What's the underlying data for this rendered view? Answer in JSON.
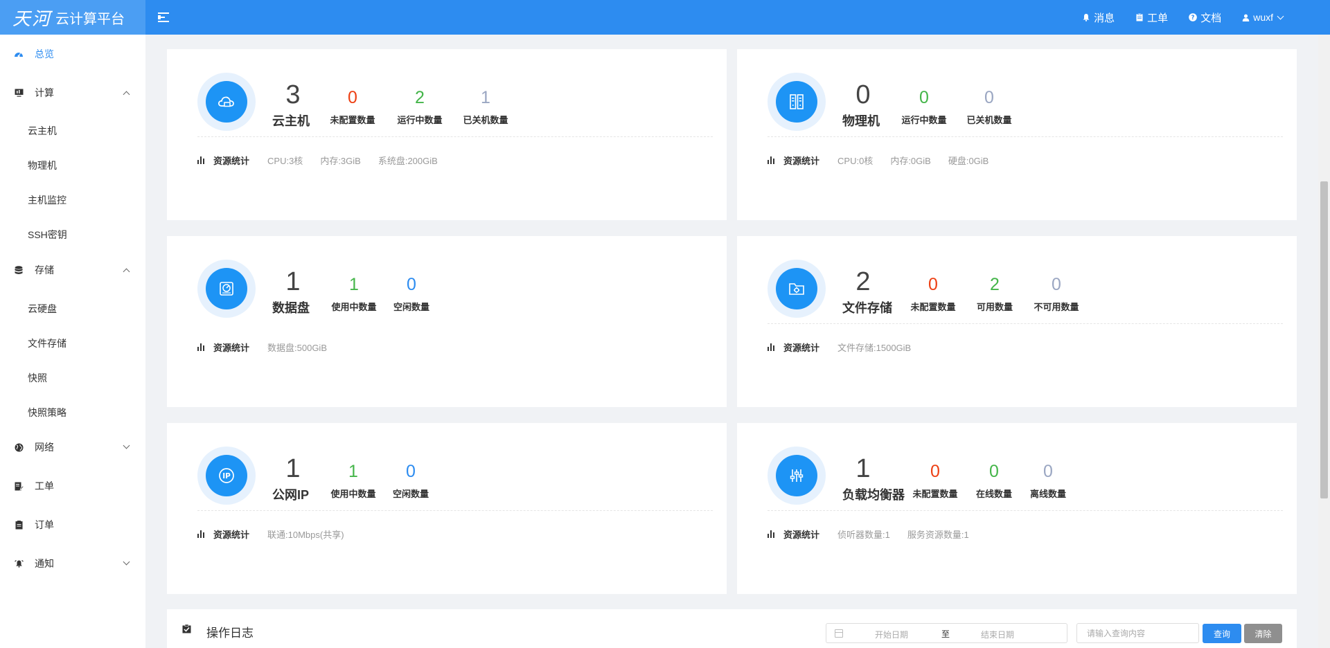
{
  "header": {
    "logo_mark": "天河",
    "logo_text": "云计算平台",
    "nav": [
      {
        "label": "消息",
        "icon": "bell-icon"
      },
      {
        "label": "工单",
        "icon": "clipboard-icon"
      },
      {
        "label": "文档",
        "icon": "question-icon"
      }
    ],
    "user": "wuxf"
  },
  "sidebar": {
    "overview": "总览",
    "compute": "计算",
    "compute_items": [
      "云主机",
      "物理机",
      "主机监控",
      "SSH密钥"
    ],
    "storage": "存储",
    "storage_items": [
      "云硬盘",
      "文件存储",
      "快照",
      "快照策略"
    ],
    "network": "网络",
    "workorder": "工单",
    "order": "订单",
    "notice": "通知"
  },
  "cards": {
    "vm": {
      "count": "3",
      "label": "云主机",
      "stats": [
        {
          "value": "0",
          "label": "未配置数量",
          "color": "#ed4014"
        },
        {
          "value": "2",
          "label": "运行中数量",
          "color": "#44b549"
        },
        {
          "value": "1",
          "label": "已关机数量",
          "color": "#9aa6c2"
        }
      ],
      "res_title": "资源统计",
      "res": [
        "CPU:3核",
        "内存:3GiB",
        "系统盘:200GiB"
      ]
    },
    "physical": {
      "count": "0",
      "label": "物理机",
      "stats": [
        {
          "value": "0",
          "label": "运行中数量",
          "color": "#44b549"
        },
        {
          "value": "0",
          "label": "已关机数量",
          "color": "#9aa6c2"
        }
      ],
      "res_title": "资源统计",
      "res": [
        "CPU:0核",
        "内存:0GiB",
        "硬盘:0GiB"
      ]
    },
    "disk": {
      "count": "1",
      "label": "数据盘",
      "stats": [
        {
          "value": "1",
          "label": "使用中数量",
          "color": "#44b549"
        },
        {
          "value": "0",
          "label": "空闲数量",
          "color": "#2d8cf0"
        }
      ],
      "res_title": "资源统计",
      "res": [
        "数据盘:500GiB"
      ]
    },
    "file": {
      "count": "2",
      "label": "文件存储",
      "stats": [
        {
          "value": "0",
          "label": "未配置数量",
          "color": "#ed4014"
        },
        {
          "value": "2",
          "label": "可用数量",
          "color": "#44b549"
        },
        {
          "value": "0",
          "label": "不可用数量",
          "color": "#9aa6c2"
        }
      ],
      "res_title": "资源统计",
      "res": [
        "文件存储:1500GiB"
      ]
    },
    "ip": {
      "count": "1",
      "label": "公网IP",
      "stats": [
        {
          "value": "1",
          "label": "使用中数量",
          "color": "#44b549"
        },
        {
          "value": "0",
          "label": "空闲数量",
          "color": "#2d8cf0"
        }
      ],
      "res_title": "资源统计",
      "res": [
        "联通:10Mbps(共享)"
      ]
    },
    "lb": {
      "count": "1",
      "label": "负载均衡器",
      "stats": [
        {
          "value": "0",
          "label": "未配置数量",
          "color": "#ed4014"
        },
        {
          "value": "0",
          "label": "在线数量",
          "color": "#44b549"
        },
        {
          "value": "0",
          "label": "离线数量",
          "color": "#9aa6c2"
        }
      ],
      "res_title": "资源统计",
      "res": [
        "侦听器数量:1",
        "服务资源数量:1"
      ]
    }
  },
  "log": {
    "title": "操作日志",
    "start_placeholder": "开始日期",
    "to": "至",
    "end_placeholder": "结束日期",
    "search_placeholder": "请输入查询内容",
    "query_label": "查询",
    "clear_label": "清除"
  }
}
